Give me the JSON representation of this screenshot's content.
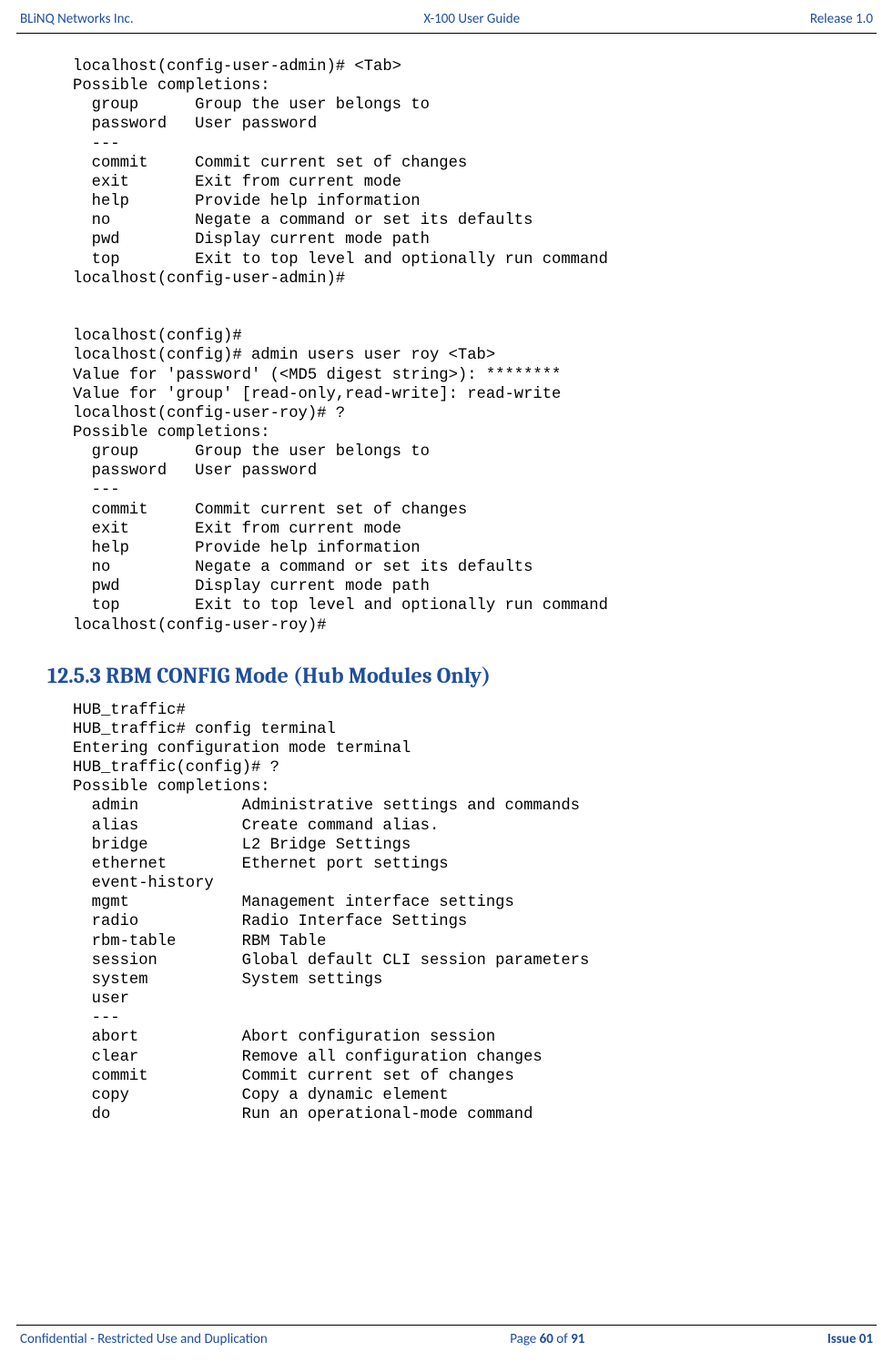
{
  "header": {
    "left": "BLiNQ Networks Inc.",
    "center": "X-100 User Guide",
    "right": "Release 1.0"
  },
  "footer": {
    "left": "Confidential - Restricted Use and Duplication",
    "center_prefix": "Page ",
    "center_num": "60",
    "center_mid": " of ",
    "center_total": "91",
    "right": "Issue 01"
  },
  "block1": "localhost(config-user-admin)# <Tab>\nPossible completions:\n  group      Group the user belongs to\n  password   User password\n  ---\n  commit     Commit current set of changes\n  exit       Exit from current mode\n  help       Provide help information\n  no         Negate a command or set its defaults\n  pwd        Display current mode path\n  top        Exit to top level and optionally run command\nlocalhost(config-user-admin)#\n\n\nlocalhost(config)#\nlocalhost(config)# admin users user roy <Tab>\nValue for 'password' (<MD5 digest string>): ********\nValue for 'group' [read-only,read-write]: read-write\nlocalhost(config-user-roy)# ?\nPossible completions:\n  group      Group the user belongs to\n  password   User password\n  ---\n  commit     Commit current set of changes\n  exit       Exit from current mode\n  help       Provide help information\n  no         Negate a command or set its defaults\n  pwd        Display current mode path\n  top        Exit to top level and optionally run command\nlocalhost(config-user-roy)#",
  "section_heading": "12.5.3   RBM CONFIG Mode (Hub Modules Only)",
  "block2": "HUB_traffic#\nHUB_traffic# config terminal\nEntering configuration mode terminal\nHUB_traffic(config)# ?\nPossible completions:\n  admin           Administrative settings and commands\n  alias           Create command alias.\n  bridge          L2 Bridge Settings\n  ethernet        Ethernet port settings\n  event-history\n  mgmt            Management interface settings\n  radio           Radio Interface Settings\n  rbm-table       RBM Table\n  session         Global default CLI session parameters\n  system          System settings\n  user\n  ---\n  abort           Abort configuration session\n  clear           Remove all configuration changes\n  commit          Commit current set of changes\n  copy            Copy a dynamic element\n  do              Run an operational-mode command"
}
